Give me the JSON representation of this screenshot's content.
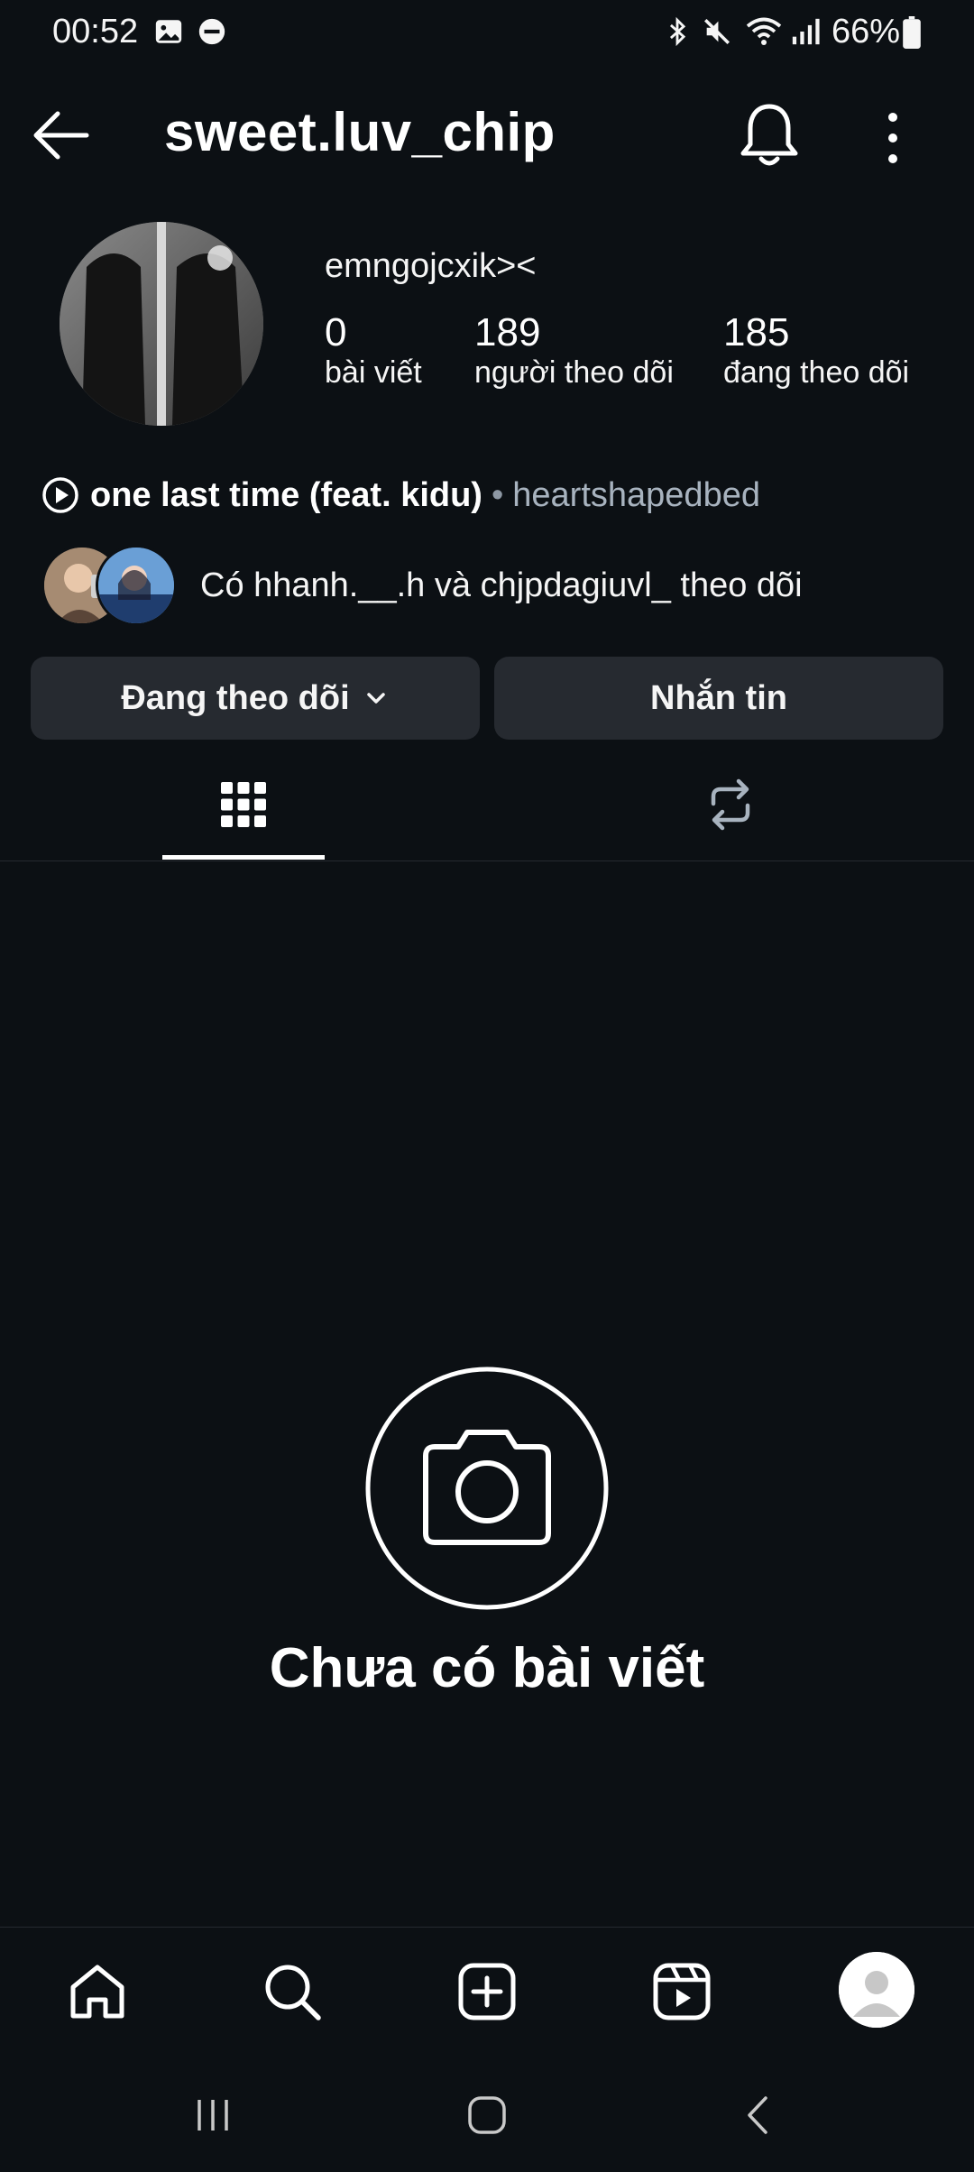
{
  "status_bar": {
    "time": "00:52",
    "battery": "66%",
    "icons_left": [
      "gallery-icon",
      "dnd-icon"
    ],
    "icons_right": [
      "bluetooth-icon",
      "mute-icon",
      "wifi-icon",
      "signal-icon",
      "battery-icon"
    ]
  },
  "header": {
    "username": "sweet.luv_chip"
  },
  "profile": {
    "full_name": "emngojcxik><",
    "stats": [
      {
        "value": "0",
        "label": "bài viết"
      },
      {
        "value": "189",
        "label": "người theo dõi"
      },
      {
        "value": "185",
        "label": "đang theo dõi"
      }
    ],
    "music": {
      "title": "one last time (feat. kidu)",
      "separator": "•",
      "artist": "heartshapedbed"
    },
    "mutual_text": "Có hhanh.__.h và chjpdagiuvl_ theo dõi"
  },
  "actions": {
    "following_label": "Đang theo dõi",
    "message_label": "Nhắn tin"
  },
  "tabs": [
    {
      "icon": "grid-icon",
      "active": true
    },
    {
      "icon": "reposts-icon",
      "active": false
    }
  ],
  "empty_state": {
    "title": "Chưa có bài viết"
  },
  "bottom_nav": [
    "home-icon",
    "search-icon",
    "create-icon",
    "reels-icon",
    "profile-avatar"
  ],
  "colors": {
    "background": "#0c1014",
    "button_bg": "#262a30",
    "muted_text": "#a8b3bf",
    "text": "#f5f5f5"
  }
}
